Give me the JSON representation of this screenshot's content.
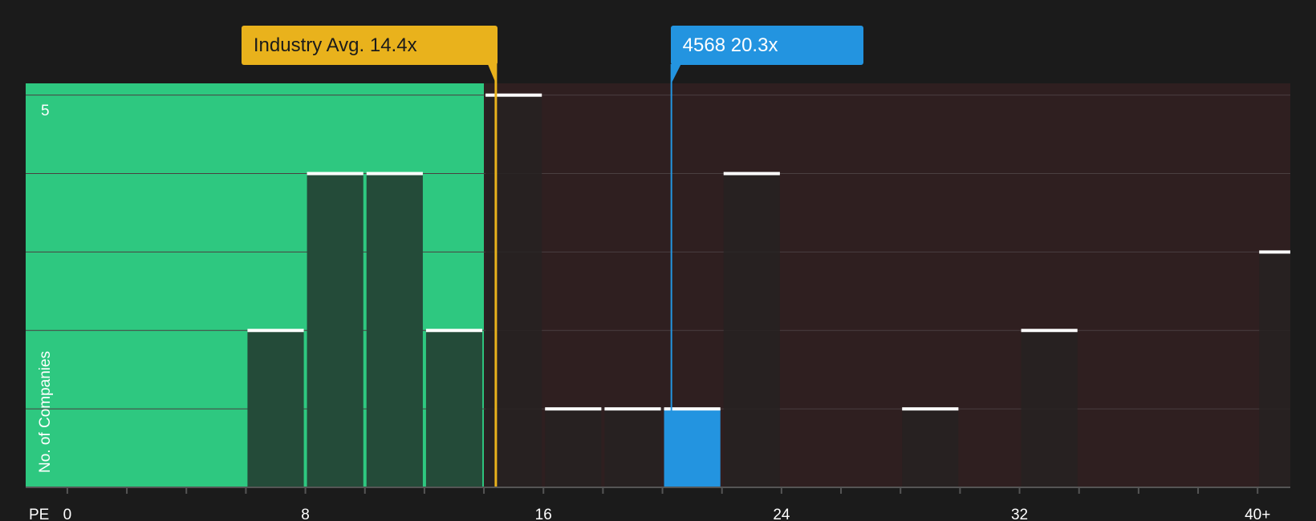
{
  "chart_data": {
    "type": "bar",
    "x_axis_label": "PE",
    "y_axis_label": "No. of Companies",
    "x_tick_labels": [
      "0",
      "8",
      "16",
      "24",
      "32",
      "40+"
    ],
    "x_tick_values": [
      0,
      8,
      16,
      24,
      32,
      40
    ],
    "y_tick_labels": [
      "5"
    ],
    "y_tick_values": [
      5
    ],
    "xlim": [
      -1.4,
      41.1
    ],
    "ylim": [
      0,
      5.15
    ],
    "bin_width": 2,
    "bins": [
      {
        "x_start": 6,
        "x_end": 8,
        "count": 2
      },
      {
        "x_start": 8,
        "x_end": 10,
        "count": 4
      },
      {
        "x_start": 10,
        "x_end": 12,
        "count": 4
      },
      {
        "x_start": 12,
        "x_end": 14,
        "count": 2
      },
      {
        "x_start": 14,
        "x_end": 16,
        "count": 5
      },
      {
        "x_start": 16,
        "x_end": 18,
        "count": 1
      },
      {
        "x_start": 18,
        "x_end": 20,
        "count": 1
      },
      {
        "x_start": 20,
        "x_end": 22,
        "count": 1,
        "highlight": true
      },
      {
        "x_start": 22,
        "x_end": 24,
        "count": 4
      },
      {
        "x_start": 28,
        "x_end": 30,
        "count": 1
      },
      {
        "x_start": 32,
        "x_end": 34,
        "count": 2
      },
      {
        "x_start": 40,
        "x_end": 42,
        "count": 3
      }
    ],
    "undervalued_region": {
      "x_start": -1.4,
      "x_end": 14.0
    },
    "industry_avg": {
      "label": "Industry Avg. 14.4x",
      "value": 14.4
    },
    "company": {
      "label": "4568 20.3x",
      "value": 20.3
    },
    "grid": true,
    "colors": {
      "background": "#1b1b1b",
      "undervalued_region": "#2ec880",
      "overvalued_region": "#2f1f20",
      "bar_in_green": "#244b39",
      "bar_dark": "#262222",
      "bar_highlight": "#2394e0",
      "bar_cap": "#ffffff",
      "industry_line": "#e9b21c",
      "company_line": "#2394e0",
      "grid": "#4a3f40"
    }
  }
}
